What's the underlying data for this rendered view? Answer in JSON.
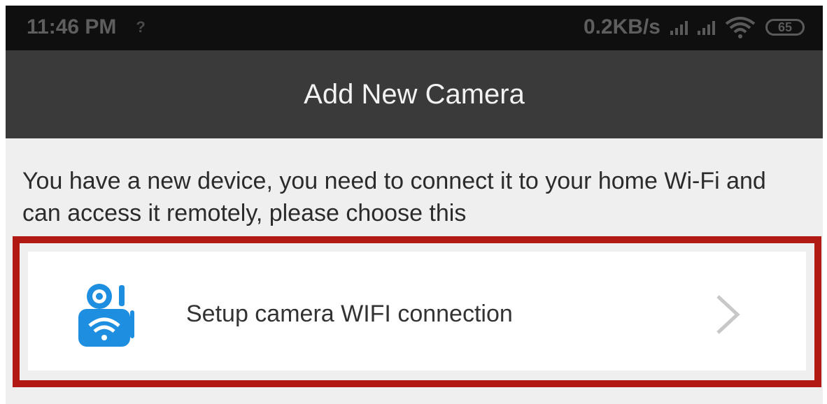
{
  "status_bar": {
    "time": "11:46 PM",
    "unknown_indicator": "?",
    "data_rate": "0.2KB/s",
    "battery_level": "65"
  },
  "app_bar": {
    "title": "Add New Camera"
  },
  "message": "You have a new device, you need to connect it to your home Wi-Fi and can access it remotely, please choose this",
  "options": [
    {
      "label": "Setup camera WIFI connection",
      "icon": "wifi-camera-icon",
      "trailing_icon": "chevron-right-icon"
    }
  ],
  "colors": {
    "status_bar_bg": "#0f0f0f",
    "app_bar_bg": "#3a3a3a",
    "page_bg": "#efefef",
    "highlight_border": "#b01a12",
    "icon_blue": "#1e8fe0"
  }
}
